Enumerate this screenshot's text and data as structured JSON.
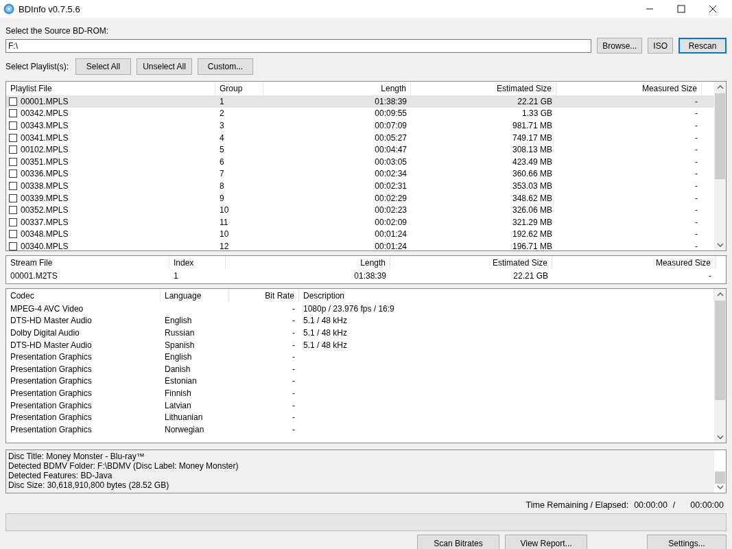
{
  "window": {
    "title": "BDInfo v0.7.5.6"
  },
  "source": {
    "label": "Select the Source BD-ROM:",
    "value": "F:\\",
    "buttons": [
      {
        "label": "Browse...",
        "focused": false
      },
      {
        "label": "ISO",
        "focused": false
      },
      {
        "label": "Rescan",
        "focused": true
      }
    ]
  },
  "playlist_select": {
    "label": "Select Playlist(s):",
    "buttons": [
      "Select All",
      "Unselect All",
      "Custom..."
    ]
  },
  "playlists": {
    "columns": [
      "Playlist File",
      "Group",
      "Length",
      "Estimated Size",
      "Measured Size"
    ],
    "rows": [
      {
        "file": "00001.MPLS",
        "group": "1",
        "length": "01:38:39",
        "estimated": "22.21 GB",
        "measured": "-",
        "checked": false,
        "selected": true
      },
      {
        "file": "00342.MPLS",
        "group": "2",
        "length": "00:09:55",
        "estimated": "1.33 GB",
        "measured": "-",
        "checked": false,
        "selected": false
      },
      {
        "file": "00343.MPLS",
        "group": "3",
        "length": "00:07:09",
        "estimated": "981.71 MB",
        "measured": "-",
        "checked": false,
        "selected": false
      },
      {
        "file": "00341.MPLS",
        "group": "4",
        "length": "00:05:27",
        "estimated": "749.17 MB",
        "measured": "-",
        "checked": false,
        "selected": false
      },
      {
        "file": "00102.MPLS",
        "group": "5",
        "length": "00:04:47",
        "estimated": "308.13 MB",
        "measured": "-",
        "checked": false,
        "selected": false
      },
      {
        "file": "00351.MPLS",
        "group": "6",
        "length": "00:03:05",
        "estimated": "423.49 MB",
        "measured": "-",
        "checked": false,
        "selected": false
      },
      {
        "file": "00336.MPLS",
        "group": "7",
        "length": "00:02:34",
        "estimated": "360.66 MB",
        "measured": "-",
        "checked": false,
        "selected": false
      },
      {
        "file": "00338.MPLS",
        "group": "8",
        "length": "00:02:31",
        "estimated": "353.03 MB",
        "measured": "-",
        "checked": false,
        "selected": false
      },
      {
        "file": "00339.MPLS",
        "group": "9",
        "length": "00:02:29",
        "estimated": "348.62 MB",
        "measured": "-",
        "checked": false,
        "selected": false
      },
      {
        "file": "00352.MPLS",
        "group": "10",
        "length": "00:02:23",
        "estimated": "326.06 MB",
        "measured": "-",
        "checked": false,
        "selected": false
      },
      {
        "file": "00337.MPLS",
        "group": "11",
        "length": "00:02:09",
        "estimated": "321.29 MB",
        "measured": "-",
        "checked": false,
        "selected": false
      },
      {
        "file": "00348.MPLS",
        "group": "10",
        "length": "00:01:24",
        "estimated": "192.62 MB",
        "measured": "-",
        "checked": false,
        "selected": false
      },
      {
        "file": "00340.MPLS",
        "group": "12",
        "length": "00:01:24",
        "estimated": "196.71 MB",
        "measured": "-",
        "checked": false,
        "selected": false
      }
    ]
  },
  "streams": {
    "columns": [
      "Stream File",
      "Index",
      "Length",
      "Estimated Size",
      "Measured Size"
    ],
    "rows": [
      {
        "file": "00001.M2TS",
        "index": "1",
        "length": "01:38:39",
        "estimated": "22.21 GB",
        "measured": "-"
      }
    ]
  },
  "codecs": {
    "columns": [
      "Codec",
      "Language",
      "Bit Rate",
      "Description"
    ],
    "rows": [
      {
        "codec": "MPEG-4 AVC Video",
        "language": "",
        "bitrate": "-",
        "description": "1080p / 23.976 fps / 16:9"
      },
      {
        "codec": "DTS-HD Master Audio",
        "language": "English",
        "bitrate": "-",
        "description": "5.1 / 48 kHz"
      },
      {
        "codec": "Dolby Digital Audio",
        "language": "Russian",
        "bitrate": "-",
        "description": "5.1 / 48 kHz"
      },
      {
        "codec": "DTS-HD Master Audio",
        "language": "Spanish",
        "bitrate": "-",
        "description": "5.1 / 48 kHz"
      },
      {
        "codec": "Presentation Graphics",
        "language": "English",
        "bitrate": "-",
        "description": ""
      },
      {
        "codec": "Presentation Graphics",
        "language": "Danish",
        "bitrate": "-",
        "description": ""
      },
      {
        "codec": "Presentation Graphics",
        "language": "Estonian",
        "bitrate": "-",
        "description": ""
      },
      {
        "codec": "Presentation Graphics",
        "language": "Finnish",
        "bitrate": "-",
        "description": ""
      },
      {
        "codec": "Presentation Graphics",
        "language": "Latvian",
        "bitrate": "-",
        "description": ""
      },
      {
        "codec": "Presentation Graphics",
        "language": "Lithuanian",
        "bitrate": "-",
        "description": ""
      },
      {
        "codec": "Presentation Graphics",
        "language": "Norwegian",
        "bitrate": "-",
        "description": ""
      }
    ]
  },
  "info": [
    "Disc Title: Money Monster - Blu-ray™",
    "Detected BDMV Folder: F:\\BDMV (Disc Label: Money Monster)",
    "Detected Features: BD-Java",
    "Disc Size: 30,618,910,800 bytes (28.52 GB)"
  ],
  "time": {
    "label": "Time Remaining / Elapsed:",
    "remaining": "00:00:00",
    "separator": "/",
    "elapsed": "00:00:00"
  },
  "progress": {
    "level": 0
  },
  "buttons": [
    "Scan Bitrates",
    "View Report...",
    "Settings..."
  ]
}
